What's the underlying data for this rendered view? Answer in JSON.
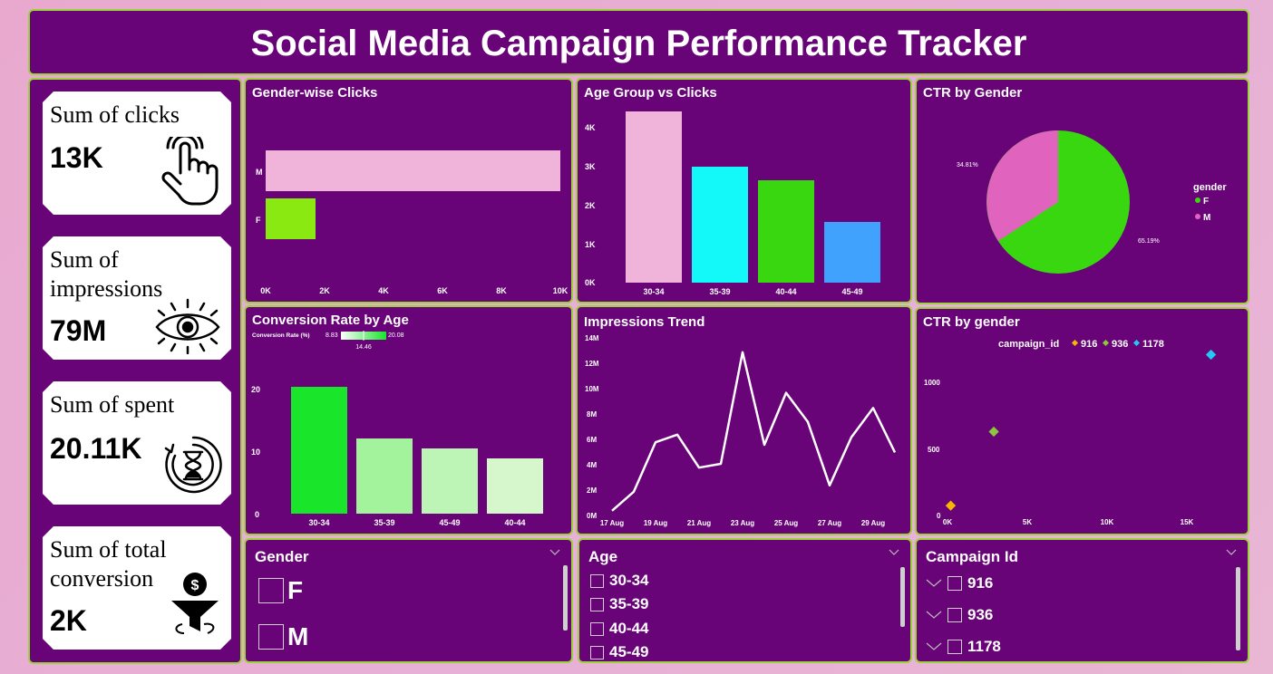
{
  "title": "Social Media Campaign Performance Tracker",
  "colors": {
    "panel_bg": "#680478",
    "panel_border": "#9bd33a",
    "pink": "#f0b3d9",
    "cyan": "#13f8f8",
    "green": "#39d70f",
    "blue": "#40a2fc",
    "magenta": "#e063bd",
    "diamond_green": "#8cc63f",
    "diamond_orange": "#f6b700",
    "diamond_cyan": "#22c9f2"
  },
  "kpis": [
    {
      "label": "Sum of clicks",
      "value": "13K",
      "icon": "pointer-hand-icon"
    },
    {
      "label": "Sum of impressions",
      "value": "79M",
      "icon": "eye-icon"
    },
    {
      "label": "Sum of spent",
      "value": "20.11K",
      "icon": "hourglass-clock-icon"
    },
    {
      "label": "Sum of total conversion",
      "value": "2K",
      "icon": "funnel-dollar-icon"
    }
  ],
  "charts": {
    "gender_clicks": {
      "title": "Gender-wise Clicks",
      "x_ticks": [
        "0K",
        "2K",
        "4K",
        "6K",
        "8K",
        "10K"
      ],
      "y_ticks": [
        "M",
        "F"
      ]
    },
    "age_clicks": {
      "title": "Age Group vs Clicks",
      "y_ticks": [
        "4K",
        "3K",
        "2K",
        "1K",
        "0K"
      ],
      "x_ticks": [
        "30-34",
        "35-39",
        "40-44",
        "45-49"
      ]
    },
    "ctr_gender": {
      "title": "CTR by Gender",
      "legend_title": "gender",
      "legend": [
        "F",
        "M"
      ],
      "label_f": "65.19%",
      "label_m": "34.81%"
    },
    "conversion_age": {
      "title": "Conversion Rate by Age",
      "legend_label": "Conversion Rate (%)",
      "legend_min": "8.83",
      "legend_mid": "14.46",
      "legend_max": "20.08",
      "y_ticks": [
        "20",
        "10",
        "0"
      ],
      "x_ticks": [
        "30-34",
        "35-39",
        "45-49",
        "40-44"
      ]
    },
    "impressions_trend": {
      "title": "Impressions Trend",
      "y_ticks": [
        "14M",
        "12M",
        "10M",
        "8M",
        "6M",
        "4M",
        "2M",
        "0M"
      ],
      "x_ticks": [
        "17 Aug",
        "19 Aug",
        "21 Aug",
        "23 Aug",
        "25 Aug",
        "27 Aug",
        "29 Aug"
      ]
    },
    "ctr_scatter": {
      "title": "CTR by gender",
      "legend_title": "campaign_id",
      "legend": [
        "916",
        "936",
        "1178"
      ],
      "y_ticks": [
        "1000",
        "500",
        "0"
      ],
      "x_ticks": [
        "0K",
        "5K",
        "10K",
        "15K"
      ]
    }
  },
  "chart_data": [
    {
      "type": "bar",
      "title": "Gender-wise Clicks",
      "orientation": "horizontal",
      "categories": [
        "M",
        "F"
      ],
      "values": [
        10000,
        1700
      ],
      "xlim": [
        0,
        10000
      ]
    },
    {
      "type": "bar",
      "title": "Age Group vs Clicks",
      "categories": [
        "30-34",
        "35-39",
        "40-44",
        "45-49"
      ],
      "values": [
        4450,
        3000,
        2650,
        1600
      ],
      "ylim": [
        0,
        4500
      ]
    },
    {
      "type": "pie",
      "title": "CTR by Gender",
      "categories": [
        "F",
        "M"
      ],
      "values": [
        65.19,
        34.81
      ]
    },
    {
      "type": "bar",
      "title": "Conversion Rate by Age",
      "categories": [
        "30-34",
        "35-39",
        "45-49",
        "40-44"
      ],
      "values": [
        20.08,
        11.9,
        10.3,
        8.83
      ],
      "ylim": [
        0,
        22
      ]
    },
    {
      "type": "line",
      "title": "Impressions Trend",
      "x": [
        "17 Aug",
        "18 Aug",
        "19 Aug",
        "20 Aug",
        "21 Aug",
        "22 Aug",
        "23 Aug",
        "24 Aug",
        "25 Aug",
        "26 Aug",
        "27 Aug",
        "28 Aug",
        "29 Aug",
        "30 Aug"
      ],
      "values": [
        0.3,
        1.8,
        5.7,
        6.3,
        3.7,
        4.0,
        12.8,
        5.5,
        9.6,
        7.3,
        2.3,
        6.1,
        8.4,
        4.9
      ],
      "ylim": [
        0,
        14
      ]
    },
    {
      "type": "scatter",
      "title": "CTR by gender",
      "series": [
        {
          "name": "916",
          "points": [
            [
              200,
              70
            ]
          ]
        },
        {
          "name": "936",
          "points": [
            [
              2900,
              550
            ]
          ]
        },
        {
          "name": "1178",
          "points": [
            [
              16500,
              1050
            ]
          ]
        }
      ],
      "xlim": [
        0,
        18000
      ],
      "ylim": [
        0,
        1250
      ]
    }
  ],
  "slicers": {
    "gender": {
      "title": "Gender",
      "items": [
        "F",
        "M"
      ]
    },
    "age": {
      "title": "Age",
      "items": [
        "30-34",
        "35-39",
        "40-44",
        "45-49"
      ]
    },
    "campaign": {
      "title": "Campaign Id",
      "items": [
        "916",
        "936",
        "1178"
      ]
    }
  }
}
